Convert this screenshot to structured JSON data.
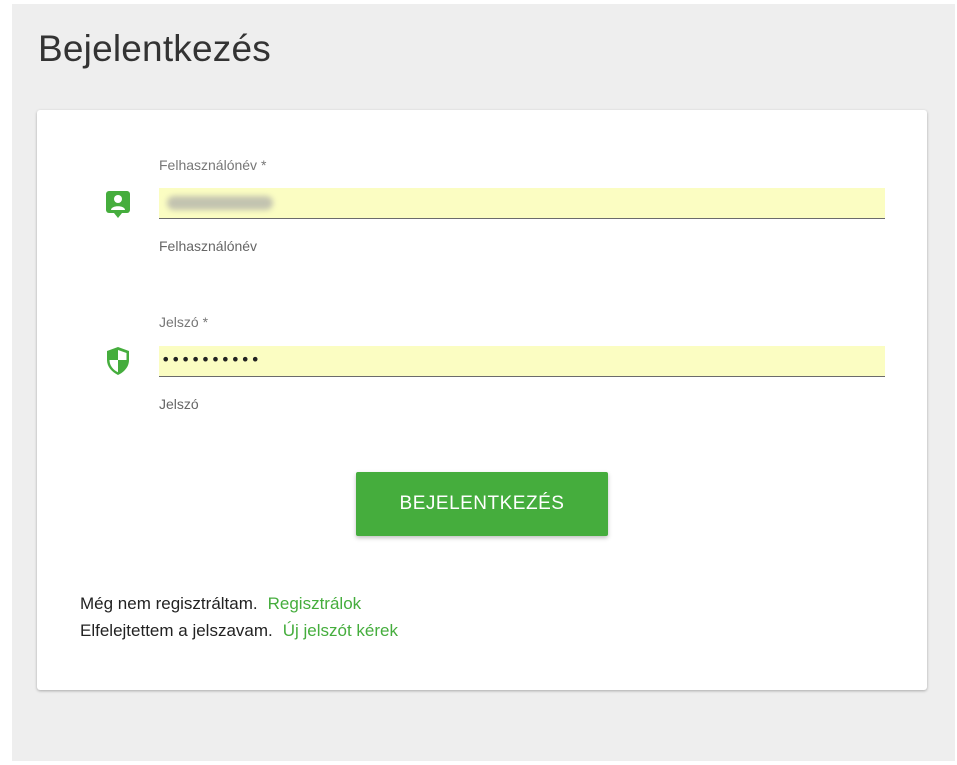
{
  "page": {
    "title": "Bejelentkezés"
  },
  "form": {
    "username": {
      "label": "Felhasználónév *",
      "hint": "Felhasználónév",
      "icon": "account-box-icon"
    },
    "password": {
      "label": "Jelszó *",
      "value_masked": "••••••••••",
      "hint": "Jelszó",
      "icon": "shield-icon"
    },
    "submit_label": "BEJELENTKEZÉS"
  },
  "links": {
    "register_prompt": "Még nem regisztráltam.",
    "register_link": "Regisztrálok",
    "forgot_prompt": "Elfelejtettem a jelszavam.",
    "forgot_link": "Új jelszót kérek"
  },
  "colors": {
    "accent": "#45ad3d",
    "input_autofill": "#fbfdc2",
    "background": "#eeeeee"
  }
}
